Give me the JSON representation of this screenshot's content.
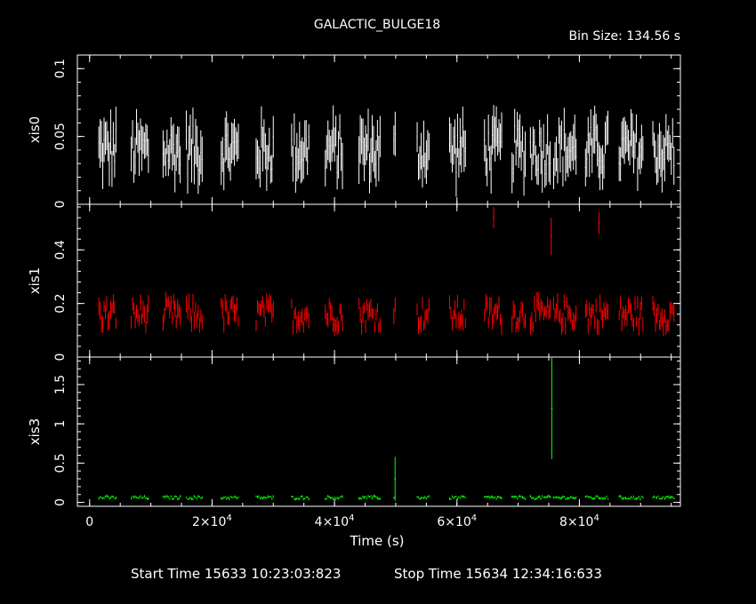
{
  "header": {
    "title": "GALACTIC_BULGE18",
    "bin_size": "Bin Size: 134.56 s"
  },
  "footer": {
    "start": "Start Time 15633 10:23:03:823",
    "stop": "Stop Time 15634 12:34:16:633"
  },
  "colors": {
    "xis0": "#ffffff",
    "xis1": "#ff0000",
    "xis3": "#00ff00",
    "axes": "#ffffff",
    "background": "#000000"
  },
  "chart_data": {
    "type": "scatter",
    "title": "GALACTIC_BULGE18",
    "xlabel": "Time (s)",
    "xlim": [
      -2000,
      96500
    ],
    "x_ticks": [
      {
        "value": 0,
        "label": "0"
      },
      {
        "value": 20000,
        "label": "2×10",
        "exp": "4"
      },
      {
        "value": 40000,
        "label": "4×10",
        "exp": "4"
      },
      {
        "value": 60000,
        "label": "6×10",
        "exp": "4"
      },
      {
        "value": 80000,
        "label": "8×10",
        "exp": "4"
      }
    ],
    "segments": [
      [
        1500,
        4500
      ],
      [
        6800,
        9800
      ],
      [
        12000,
        15000
      ],
      [
        15800,
        18500
      ],
      [
        21500,
        24500
      ],
      [
        27200,
        30200
      ],
      [
        33000,
        36000
      ],
      [
        38500,
        41500
      ],
      [
        44000,
        47500
      ],
      [
        49700,
        50100
      ],
      [
        53500,
        55500
      ],
      [
        58800,
        61500
      ],
      [
        64500,
        67300
      ],
      [
        69000,
        71200
      ],
      [
        72000,
        75300
      ],
      [
        75800,
        79500
      ],
      [
        81000,
        84800
      ],
      [
        86500,
        90500
      ],
      [
        92000,
        95500
      ]
    ],
    "panels": [
      {
        "name": "xis0",
        "ylabel": "xis0",
        "color": "#ffffff",
        "ylim": [
          0,
          0.11
        ],
        "yticks": [
          0,
          0.05,
          0.1
        ],
        "ytick_labels": [
          "0",
          "0.05",
          "0.1"
        ],
        "mean": 0.04,
        "spread": 0.018,
        "err": 0.015,
        "spikes": []
      },
      {
        "name": "xis1",
        "ylabel": "xis1",
        "color": "#ff0000",
        "ylim": [
          0,
          0.57
        ],
        "yticks": [
          0,
          0.2,
          0.4
        ],
        "ytick_labels": [
          "0",
          "0.2",
          "0.4"
        ],
        "mean": 0.16,
        "spread": 0.05,
        "err": 0.03,
        "spikes": [
          {
            "x": 66000,
            "y": 0.52,
            "err": 0.04
          },
          {
            "x": 75400,
            "y": 0.45,
            "err": 0.07
          },
          {
            "x": 83200,
            "y": 0.5,
            "err": 0.04
          }
        ]
      },
      {
        "name": "xis3",
        "ylabel": "xis3",
        "color": "#00ff00",
        "ylim": [
          -0.05,
          1.85
        ],
        "yticks": [
          0,
          0.5,
          1,
          1.5
        ],
        "ytick_labels": [
          "0",
          "0.5",
          "1",
          "1.5"
        ],
        "mean": 0.06,
        "spread": 0.02,
        "err": 0.015,
        "spikes": [
          {
            "x": 49900,
            "y": 0.3,
            "err": 0.28
          },
          {
            "x": 75500,
            "y": 1.2,
            "err": 0.65
          }
        ]
      }
    ]
  }
}
